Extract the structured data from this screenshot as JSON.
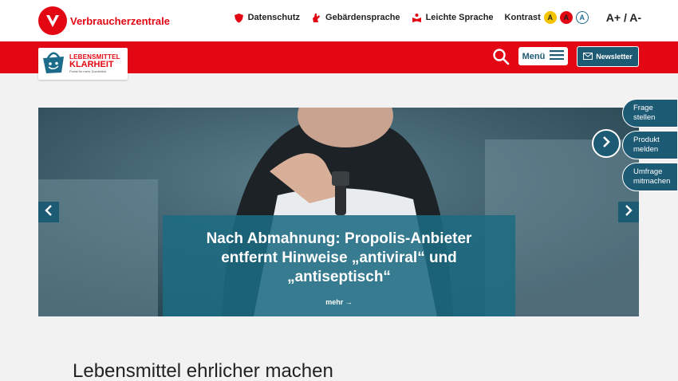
{
  "brand": {
    "name": "Verbraucherzentrale",
    "primary_color": "#e30613",
    "secondary_color": "#1d5a73"
  },
  "top_links": [
    {
      "label": "Datenschutz",
      "icon": "shield-icon"
    },
    {
      "label": "Gebärdensprache",
      "icon": "hand-icon"
    },
    {
      "label": "Leichte Sprache",
      "icon": "easy-language-icon"
    }
  ],
  "contrast": {
    "label": "Kontrast",
    "options": [
      "A",
      "A",
      "A"
    ]
  },
  "font_size": {
    "label": "A+ / A-"
  },
  "portal_logo": {
    "line1": "LEBENSMITTEL",
    "line2": "KLARHEIT",
    "tagline": "Portal für mehr Durchblick"
  },
  "nav": {
    "menu_label": "Menü",
    "newsletter_label": "Newsletter",
    "search_icon": "search-icon"
  },
  "hero": {
    "title": "Nach Abmahnung: Propolis-Anbieter entfernt Hinweise „antiviral“ und „antiseptisch“",
    "more": "mehr →"
  },
  "side_tabs": [
    {
      "line1": "Frage",
      "line2": "stellen"
    },
    {
      "line1": "Produkt",
      "line2": "melden"
    },
    {
      "line1": "Umfrage",
      "line2": "mitmachen"
    }
  ],
  "section": {
    "title": "Lebensmittel ehrlicher machen"
  }
}
